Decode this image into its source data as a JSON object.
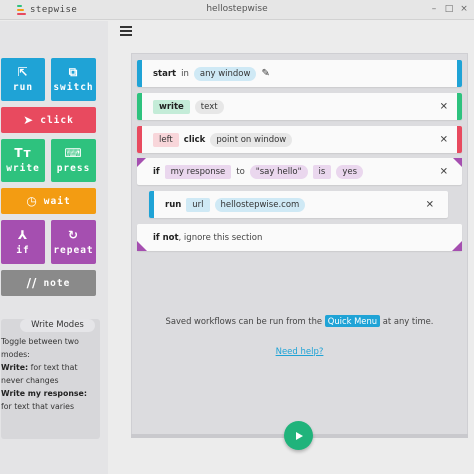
{
  "app": {
    "logo_text": "stepwise",
    "window_title": "hellostepwise",
    "window_controls": [
      "–",
      "□",
      "×"
    ]
  },
  "sidebar": {
    "tiles": [
      {
        "label": "run",
        "icon": "⇱",
        "color": "#1fa3d6"
      },
      {
        "label": "switch",
        "icon": "⧉",
        "color": "#1fa3d6"
      },
      {
        "label": "click",
        "icon": "➤",
        "color": "#e84a5f"
      },
      {
        "label": "write",
        "icon": "Tт",
        "color": "#2ec27e"
      },
      {
        "label": "press",
        "icon": "⌨",
        "color": "#2ec27e"
      },
      {
        "label": "wait",
        "icon": "◷",
        "color": "#f39c12"
      },
      {
        "label": "if",
        "icon": "⅄",
        "color": "#a54fb0"
      },
      {
        "label": "repeat",
        "icon": "↻",
        "color": "#a54fb0"
      },
      {
        "label": "note",
        "icon": "//",
        "color": "#8a8a8a"
      }
    ],
    "write_modes": {
      "title": "Write Modes",
      "intro": "Toggle between two modes:",
      "write_label": "Write:",
      "write_desc": "for text that never changes",
      "response_label": "Write my response:",
      "response_desc": "for text that varies"
    }
  },
  "workflow": {
    "start": {
      "keyword": "start",
      "prep": "in",
      "value": "any window"
    },
    "write": {
      "keyword": "write",
      "value": "text"
    },
    "click": {
      "modifier": "left",
      "keyword": "click",
      "value": "point on window"
    },
    "if": {
      "keyword": "if",
      "var": "my response",
      "prep": "to",
      "value": "\"say hello\"",
      "op": "is",
      "result": "yes"
    },
    "run": {
      "keyword": "run",
      "type": "url",
      "value": "hellostepwise.com"
    },
    "if_not": {
      "keyword": "if not",
      "text": ", ignore this section"
    }
  },
  "info": {
    "saved_pre": "Saved workflows can be run from the",
    "quick_menu": "Quick Menu",
    "saved_post": "at any time.",
    "help_link": "Need help?"
  },
  "colors": {
    "blue": "#1fa3d6",
    "red": "#e84a5f",
    "green": "#2ec27e",
    "orange": "#f39c12",
    "purple": "#a54fb0",
    "gray": "#8a8a8a",
    "play": "#20b37b"
  }
}
